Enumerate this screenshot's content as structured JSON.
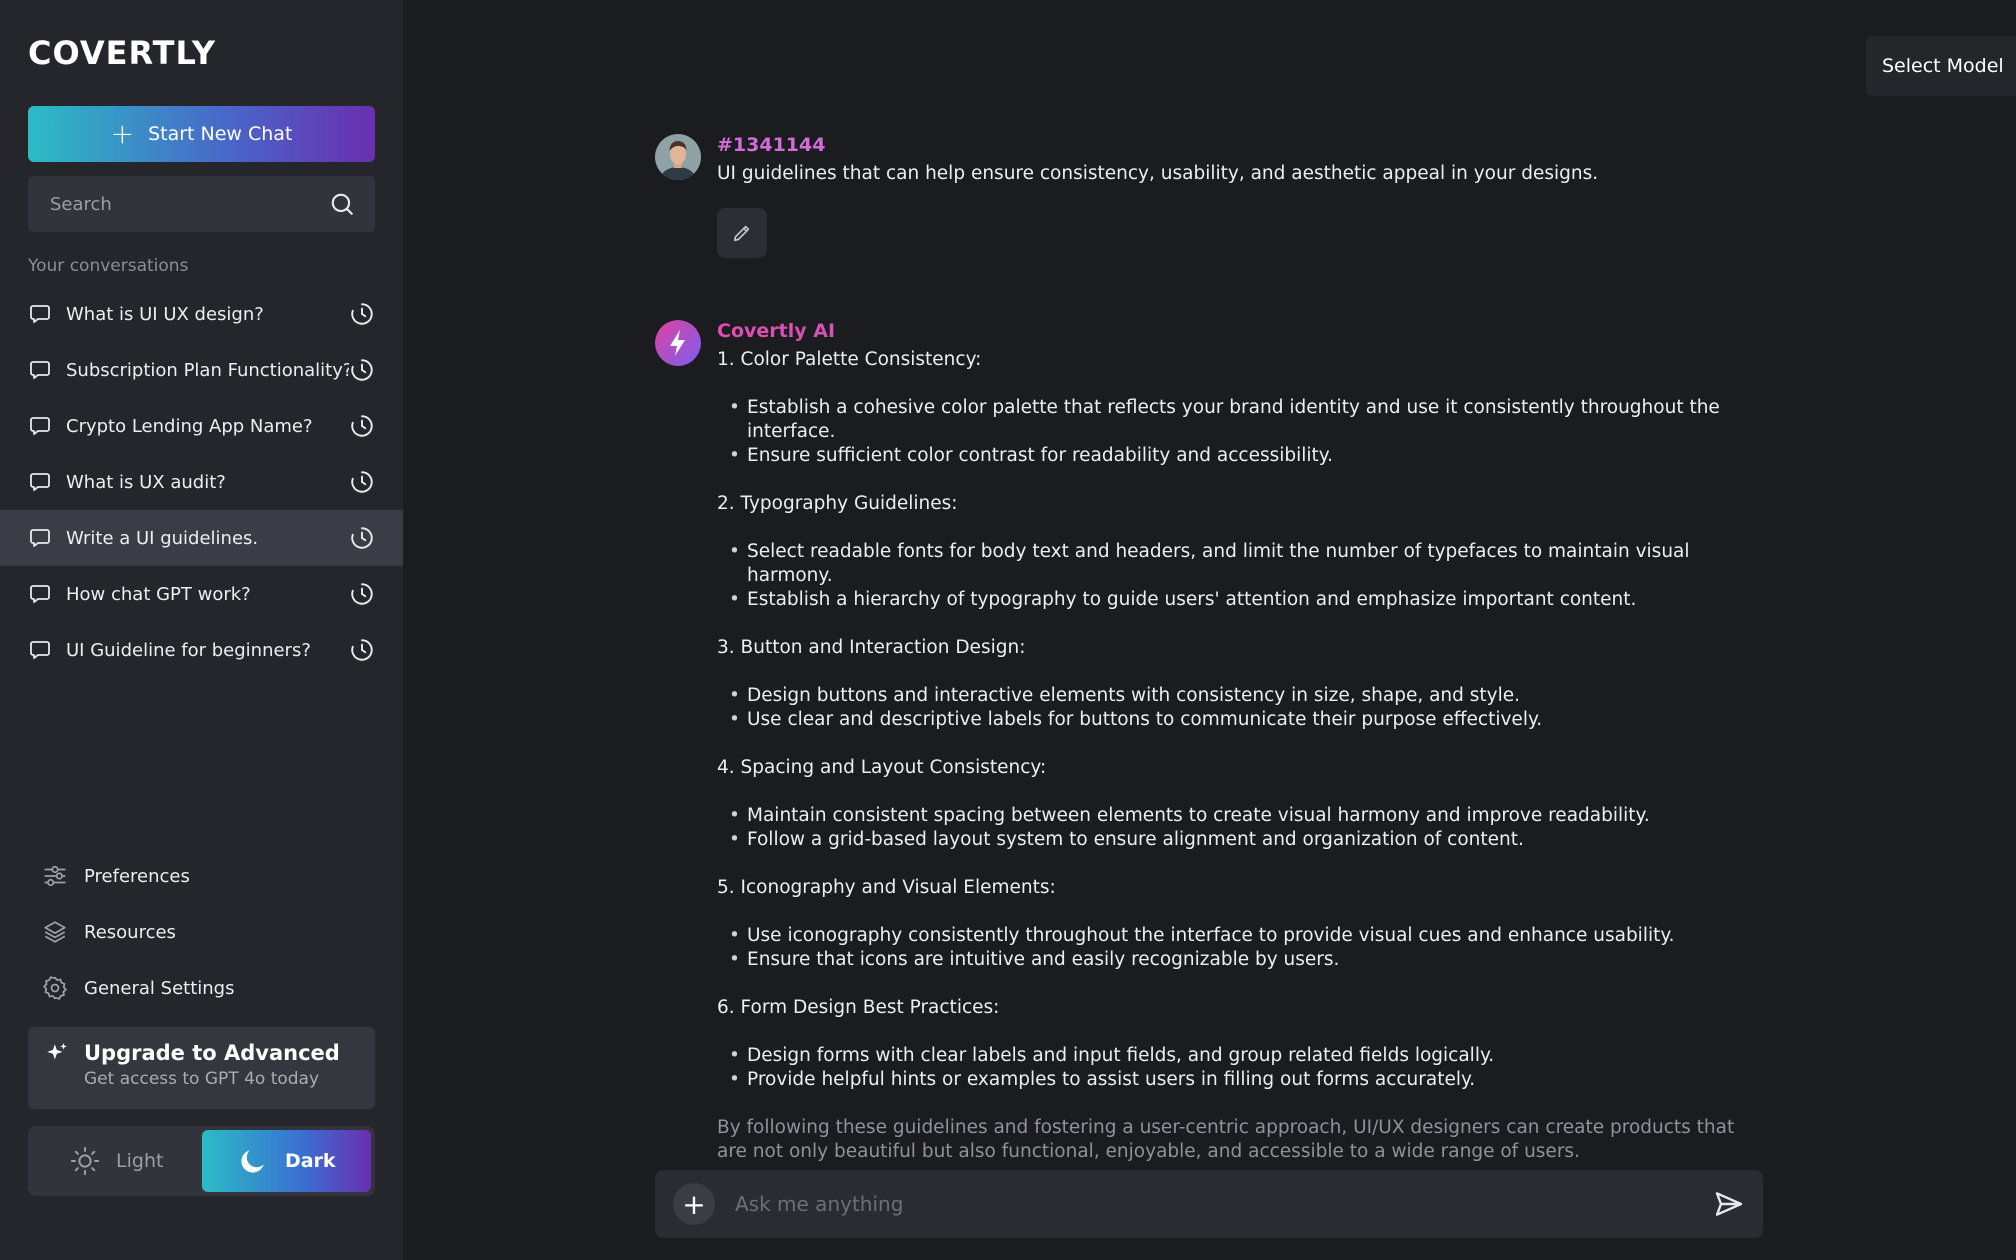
{
  "brand": {
    "logo_text": "COVERTLY"
  },
  "sidebar": {
    "new_chat_label": "Start New Chat",
    "search_placeholder": "Search",
    "conversations_heading": "Your conversations",
    "conversations": [
      {
        "label": "What is UI UX design?"
      },
      {
        "label": "Subscription Plan Functionality?"
      },
      {
        "label": "Crypto Lending App Name?"
      },
      {
        "label": "What is UX audit?"
      },
      {
        "label": "Write a UI guidelines.",
        "active": true
      },
      {
        "label": "How chat GPT work?"
      },
      {
        "label": "UI Guideline for beginners?"
      }
    ],
    "menu": [
      {
        "label": "Preferences",
        "icon": "sliders-icon"
      },
      {
        "label": "Resources",
        "icon": "layers-icon"
      },
      {
        "label": "General Settings",
        "icon": "gear-icon"
      }
    ],
    "upgrade": {
      "title": "Upgrade to Advanced",
      "subtitle": "Get access to GPT 4o today"
    },
    "theme": {
      "light_label": "Light",
      "dark_label": "Dark",
      "selected": "Dark"
    }
  },
  "header": {
    "model_select_label": "Select Model"
  },
  "chat": {
    "user_message": {
      "sender": "#1341144",
      "text": "UI guidelines that can help ensure consistency, usability, and aesthetic appeal in your designs."
    },
    "ai_message": {
      "sender": "Covertly AI",
      "sections": [
        {
          "title": "1. Color Palette Consistency:",
          "items": [
            "Establish a cohesive color palette that reflects your brand identity and use it consistently throughout the interface.",
            "Ensure sufficient color contrast for readability and accessibility."
          ]
        },
        {
          "title": "2. Typography Guidelines:",
          "items": [
            "Select readable fonts for body text and headers, and limit the number of typefaces to maintain visual harmony.",
            "Establish a hierarchy of typography to guide users' attention and emphasize important content."
          ]
        },
        {
          "title": "3. Button and Interaction Design:",
          "items": [
            "Design buttons and interactive elements with consistency in size, shape, and style.",
            "Use clear and descriptive labels for buttons to communicate their purpose effectively."
          ]
        },
        {
          "title": "4. Spacing and Layout Consistency:",
          "items": [
            "Maintain consistent spacing between elements to create visual harmony and improve readability.",
            "Follow a grid-based layout system to ensure alignment and organization of content."
          ]
        },
        {
          "title": "5. Iconography and Visual Elements:",
          "items": [
            "Use iconography consistently throughout the interface to provide visual cues and enhance usability.",
            "Ensure that icons are intuitive and easily recognizable by users."
          ]
        },
        {
          "title": "6. Form Design Best Practices:",
          "items": [
            "Design forms with clear labels and input fields, and group related fields logically.",
            "Provide helpful hints or examples to assist users in filling out forms accurately."
          ]
        }
      ],
      "closing": "By following these guidelines and fostering a user-centric approach, UI/UX designers can create products that are not only beautiful but also functional, enjoyable, and accessible to a wide range of users."
    }
  },
  "composer": {
    "placeholder": "Ask me anything"
  }
}
